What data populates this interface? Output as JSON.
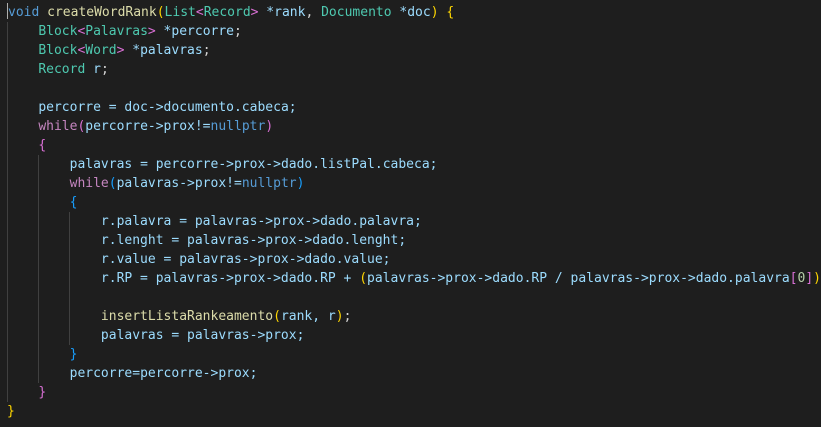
{
  "editor": {
    "language": "cpp",
    "theme": "dark",
    "line_count": 21,
    "code": {
      "l1_kw": "void",
      "l1_fn": "createWordRank",
      "l1_p1": "(",
      "l1_t1": "List",
      "l1_t1a": "<",
      "l1_t2": "Record",
      "l1_t1b": ">",
      "l1_v1": " *rank",
      "l1_c1": ", ",
      "l1_t3": "Documento",
      "l1_v2": " *doc",
      "l1_p2": ")",
      "l1_sp": " ",
      "l1_b1": "{",
      "l2_t1": "Block",
      "l2_a": "<",
      "l2_t2": "Palavras",
      "l2_b": ">",
      "l2_v": " *percorre",
      "l2_semi": ";",
      "l3_t1": "Block",
      "l3_a": "<",
      "l3_t2": "Word",
      "l3_b": ">",
      "l3_v": " *palavras",
      "l3_semi": ";",
      "l4_t1": "Record",
      "l4_v": " r",
      "l4_semi": ";",
      "l6_text": "percorre = doc->documento.cabeca;",
      "l7_kw": "while",
      "l7_p1": "(",
      "l7_text": "percorre->prox!=",
      "l7_kw2": "nullptr",
      "l7_p2": ")",
      "l8_b": "{",
      "l9_text": "palavras = percorre->prox->dado.listPal.cabeca;",
      "l10_kw": "while",
      "l10_p1": "(",
      "l10_text": "palavras->prox!=",
      "l10_kw2": "nullptr",
      "l10_p2": ")",
      "l11_b": "{",
      "l12_text": "r.palavra = palavras->prox->dado.palavra;",
      "l13_text": "r.lenght = palavras->prox->dado.lenght;",
      "l14_text": "r.value = palavras->prox->dado.value;",
      "l15_a": "r.RP = palavras->prox->dado.RP + ",
      "l15_p1": "(",
      "l15_b": "palavras->prox->dado.RP / palavras->prox->dado.palavra",
      "l15_s1": "[",
      "l15_num": "0",
      "l15_s2": "]",
      "l15_p2": ")",
      "l15_semi": ";",
      "l17_fn": "insertListaRankeamento",
      "l17_p1": "(",
      "l17_args": "rank, r",
      "l17_p2": ")",
      "l17_semi": ";",
      "l18_text": "palavras = palavras->prox;",
      "l19_b": "}",
      "l20_text": "percorre=percorre->prox;",
      "l21_b": "}",
      "l22_b": "}"
    }
  }
}
